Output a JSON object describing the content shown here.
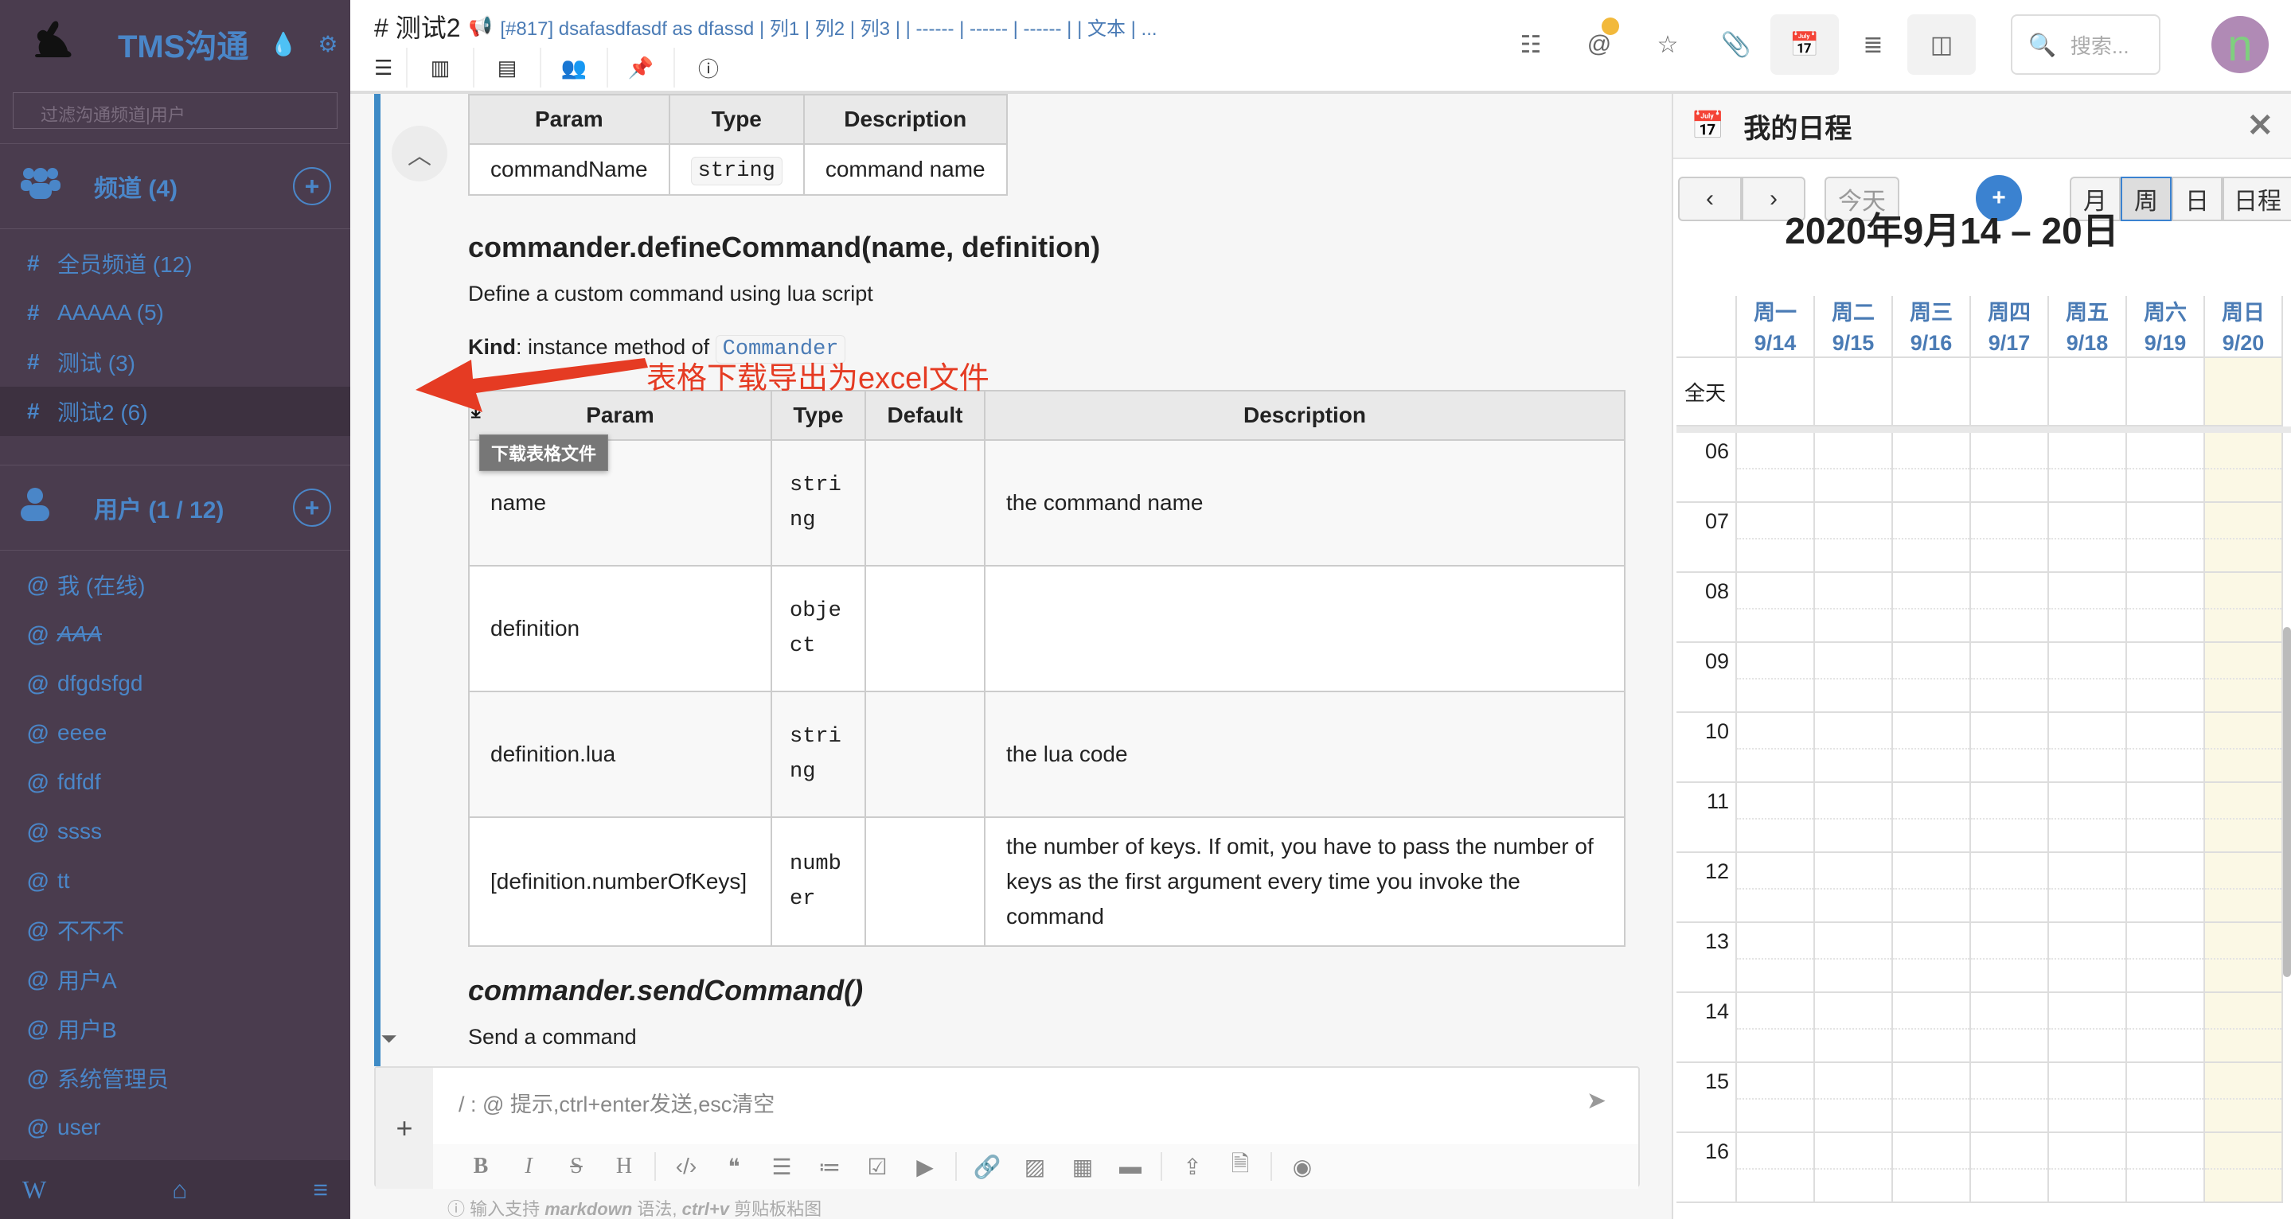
{
  "sidebar": {
    "app_title": "TMS沟通",
    "filter_placeholder": "过滤沟通频道|用户",
    "channels_header": "频道 (4)",
    "channels": [
      {
        "prefix": "#",
        "label": "全员频道 (12)"
      },
      {
        "prefix": "#",
        "label": "AAAAA (5)"
      },
      {
        "prefix": "#",
        "label": "测试 (3)"
      },
      {
        "prefix": "#",
        "label": "测试2 (6)",
        "active": true
      }
    ],
    "users_header": "用户 (1 / 12)",
    "users": [
      {
        "prefix": "@",
        "label": "我 (在线)"
      },
      {
        "prefix": "@",
        "label": "AAA",
        "disabled": true
      },
      {
        "prefix": "@",
        "label": "dfgdsfgd"
      },
      {
        "prefix": "@",
        "label": "eeee"
      },
      {
        "prefix": "@",
        "label": "fdfdf"
      },
      {
        "prefix": "@",
        "label": "ssss"
      },
      {
        "prefix": "@",
        "label": "tt"
      },
      {
        "prefix": "@",
        "label": "不不不"
      },
      {
        "prefix": "@",
        "label": "用户A"
      },
      {
        "prefix": "@",
        "label": "用户B"
      },
      {
        "prefix": "@",
        "label": "系统管理员"
      },
      {
        "prefix": "@",
        "label": "user"
      }
    ],
    "footer": {
      "wiki": "W",
      "home": "⌂",
      "menu": "≡"
    }
  },
  "header": {
    "channel_title": "# 测试2",
    "announcement": "[#817] dsafasdfasdf as dfassd | 列1 | 列2 | 列3 | | ------ | ------ | ------ | | 文本 | ...",
    "search_placeholder": "搜索...",
    "avatar_letter": "n",
    "colors": {
      "accent": "#4a86c8",
      "sidebar": "#4a3c4e",
      "notify_dot": "#f2b93b"
    }
  },
  "doc": {
    "table1": {
      "headers": [
        "Param",
        "Type",
        "Description"
      ],
      "rows": [
        [
          "commandName",
          "string",
          "command name"
        ]
      ]
    },
    "section1_title": "commander.defineCommand(name, definition)",
    "section1_desc": "Define a custom command using lua script",
    "kind_label": "Kind",
    "kind_text": ": instance method of ",
    "kind_link": "Commander",
    "table2": {
      "headers": [
        "Param",
        "Type",
        "Default",
        "Description"
      ],
      "rows": [
        [
          "name",
          "string",
          "",
          "the command name"
        ],
        [
          "definition",
          "object",
          "",
          ""
        ],
        [
          "definition.lua",
          "string",
          "",
          "the lua code"
        ],
        [
          "[definition.numberOfKeys]",
          "number",
          "",
          "the number of keys. If omit, you have to pass the number of keys as the first argument every time you invoke the command"
        ]
      ]
    },
    "download_tooltip": "下载表格文件",
    "annotation": "表格下载导出为excel文件",
    "section2_title": "commander.sendCommand()",
    "section2_desc": "Send a command"
  },
  "compose": {
    "placeholder": "/ : @ 提示,ctrl+enter发送,esc清空",
    "hint_pre": "输入支持 ",
    "hint_md": "markdown",
    "hint_mid": " 语法, ",
    "hint_key": "ctrl+v",
    "hint_post": " 剪贴板粘图"
  },
  "calendar": {
    "title": "我的日程",
    "today": "今天",
    "views": [
      "月",
      "周",
      "日",
      "日程"
    ],
    "active_view": "周",
    "range_title": "2020年9月14 – 20日",
    "days": [
      {
        "dow": "周一",
        "date": "9/14"
      },
      {
        "dow": "周二",
        "date": "9/15"
      },
      {
        "dow": "周三",
        "date": "9/16"
      },
      {
        "dow": "周四",
        "date": "9/17"
      },
      {
        "dow": "周五",
        "date": "9/18"
      },
      {
        "dow": "周六",
        "date": "9/19"
      },
      {
        "dow": "周日",
        "date": "9/20"
      }
    ],
    "allday_label": "全天",
    "hours": [
      "06",
      "07",
      "08",
      "09",
      "10",
      "11",
      "12",
      "13",
      "14",
      "15",
      "16"
    ]
  }
}
